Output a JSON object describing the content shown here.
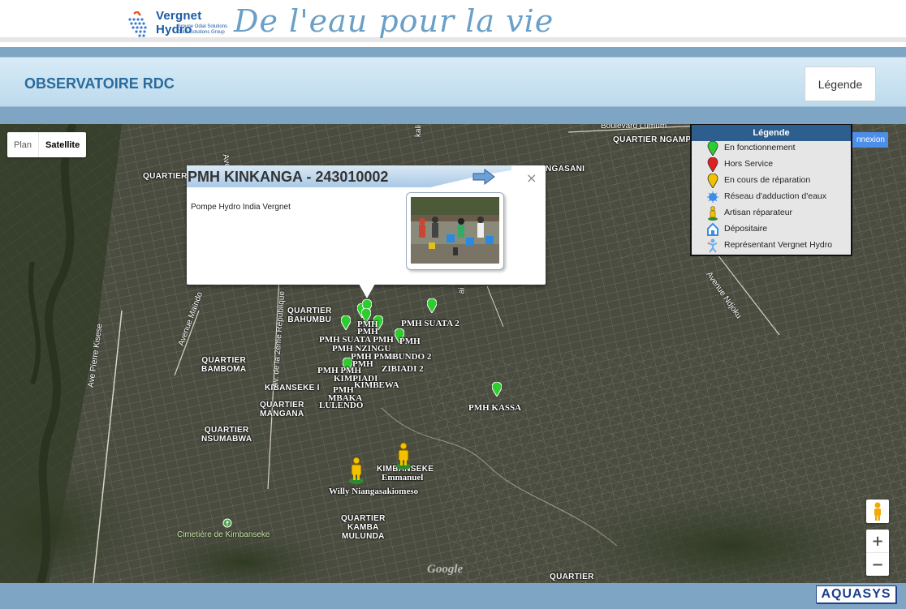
{
  "top": {
    "brand_name": "Vergnet Hydro",
    "brand_sub1": "Groupe Odial Solutions",
    "brand_sub2": "Odial Solutions Group",
    "tagline": "De l'eau pour la vie"
  },
  "header": {
    "title": "OBSERVATOIRE RDC",
    "legend_button": "Légende"
  },
  "map_controls": {
    "plan": "Plan",
    "satellite": "Satellite",
    "zoom_in": "+",
    "zoom_out": "−",
    "connexion": "nnexion",
    "google": "Google"
  },
  "popup": {
    "title": "PMH KINKANGA - 243010002",
    "description": "Pompe Hydro India Vergnet",
    "close": "×"
  },
  "legend": {
    "title": "Légende",
    "items": [
      {
        "label": "En fonctionnement",
        "icon": "green-pin-icon",
        "color": "#2ecc2e"
      },
      {
        "label": "Hors Service",
        "icon": "red-pin-icon",
        "color": "#e02020"
      },
      {
        "label": "En cours de réparation",
        "icon": "yellow-pin-icon",
        "color": "#f2c200"
      },
      {
        "label": "Réseau d'adduction d'eaux",
        "icon": "water-network-icon",
        "color": "#3a8ee6"
      },
      {
        "label": "Artisan réparateur",
        "icon": "artisan-icon",
        "color": "#f2c200"
      },
      {
        "label": "Dépositaire",
        "icon": "depot-icon",
        "color": "#3a8ee6"
      },
      {
        "label": "Représentant Vergnet Hydro",
        "icon": "representative-icon",
        "color": "#6fb0e8"
      }
    ]
  },
  "map_labels": {
    "quartiers": [
      "QUARTIER\nNGAMPANI",
      "QUARTIER",
      "QUARTIER\nBAHUMBU",
      "QUARTIER\nBAMBOMA",
      "KIBANSEKE I",
      "QUARTIER\nMANGANA",
      "QUARTIER\nNSUMABWA",
      "KIMBANSEKE",
      "QUARTIER\nKAMBA\nMULUNDA",
      "QUARTIER",
      "NGASANI"
    ],
    "roads": [
      "Boulevard Lumum",
      "Avenue Ndjoku",
      "Avenue Ndjoku",
      "Ave Pierre Kisese",
      "Avenue Maïndo",
      "Av. de la 2ème République",
      "Ave",
      "kali",
      "ai"
    ],
    "places": [
      "Cimetière de Kimbanseke"
    ],
    "pmh": [
      "PMH SUATA 2",
      "PMH KASSA",
      "PMH",
      "PMH SUATA PMH",
      "PMH NZINGU",
      "PMH",
      "PMH PMH",
      "MBUNDO 2",
      "PMH PMH",
      "ZIBIADI 2",
      "KIMPIADI",
      "KIMBEWA",
      "PMH",
      "MBAKA",
      "LULENDO",
      "PMH",
      "PMH"
    ],
    "artisans": [
      "Emmanuel",
      "Willy Niangasakiomeso"
    ]
  },
  "footer": {
    "logo": "AQUASYS"
  }
}
